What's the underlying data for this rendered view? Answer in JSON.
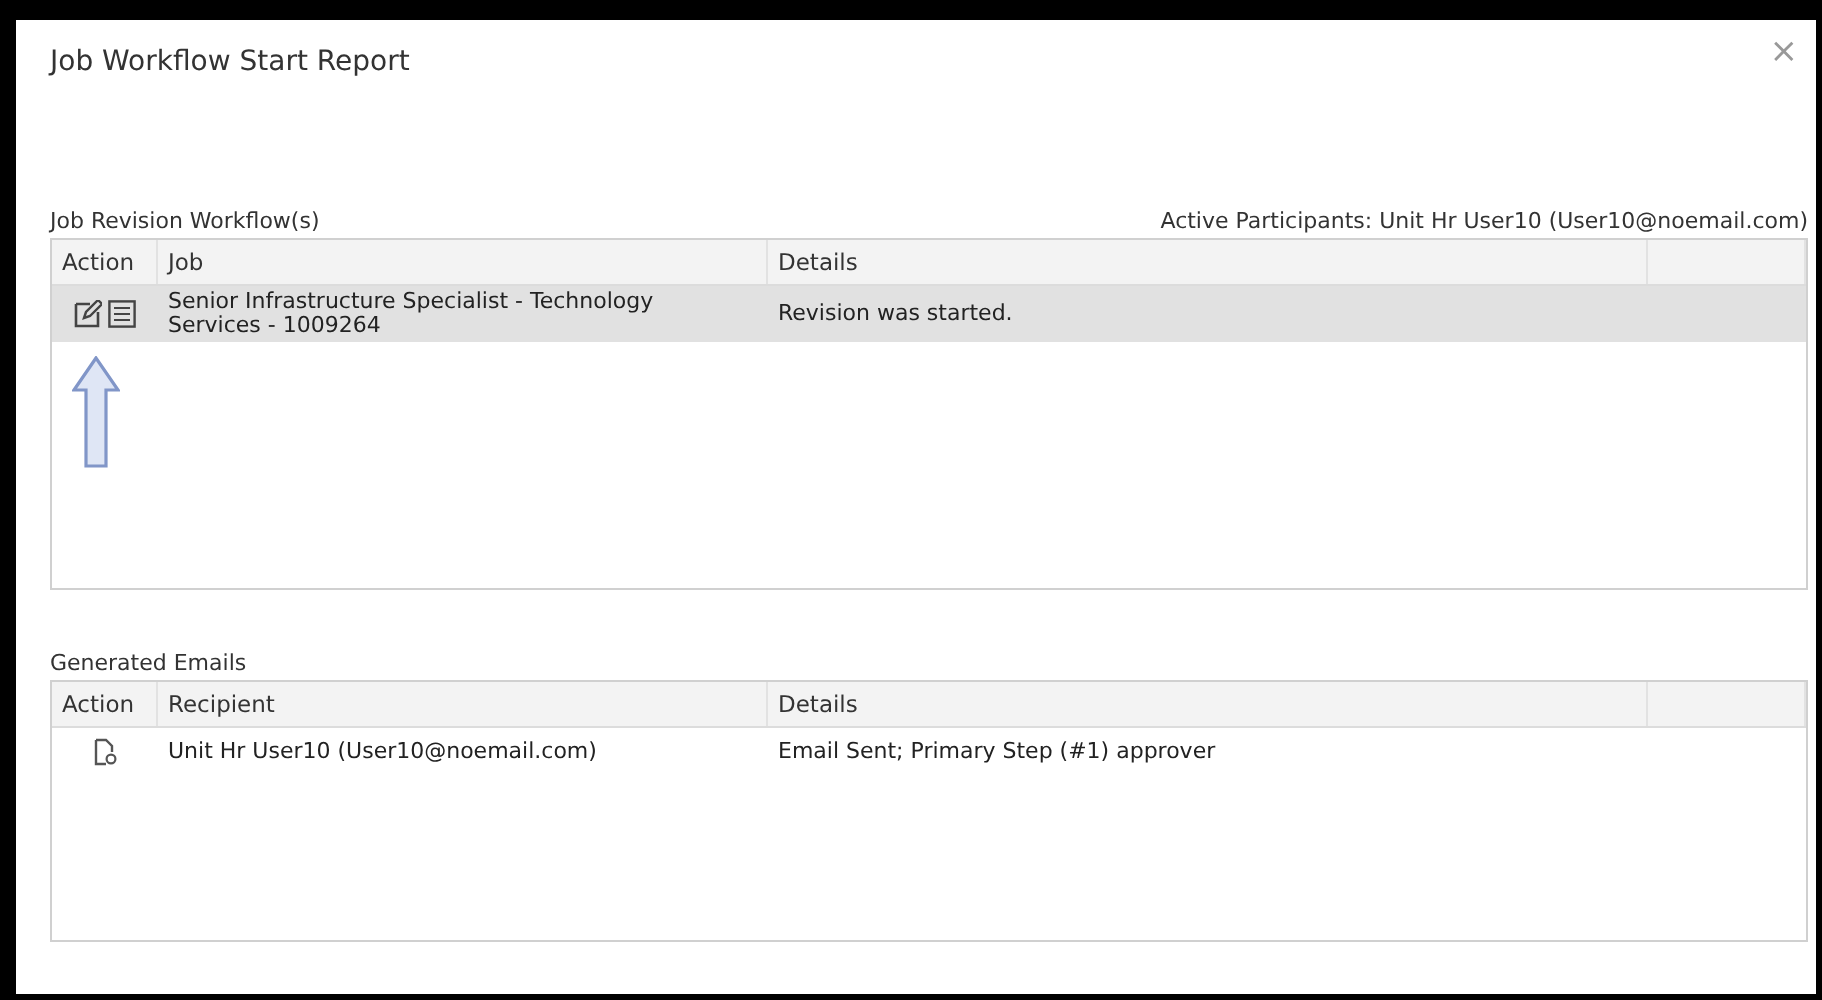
{
  "dialog": {
    "title": "Job Workflow Start Report",
    "close": "×"
  },
  "workflows": {
    "label": "Job Revision Workflow(s)",
    "participants": "Active Participants: Unit Hr User10 (User10@noemail.com)",
    "columns": [
      "Action",
      "Job",
      "Details"
    ],
    "rows": [
      {
        "actions": [
          {
            "kind": "edit"
          },
          {
            "kind": "list"
          }
        ],
        "job": "Senior Infrastructure Specialist - Technology Services - 1009264",
        "details": "Revision was started.",
        "selected": true
      }
    ]
  },
  "emails": {
    "label": "Generated Emails",
    "columns": [
      "Action",
      "Recipient",
      "Details"
    ],
    "rows": [
      {
        "actions": [
          {
            "kind": "view"
          }
        ],
        "recipient": "Unit Hr User10 (User10@noemail.com)",
        "details": "Email Sent; Primary Step (#1) approver",
        "selected": false
      }
    ]
  }
}
